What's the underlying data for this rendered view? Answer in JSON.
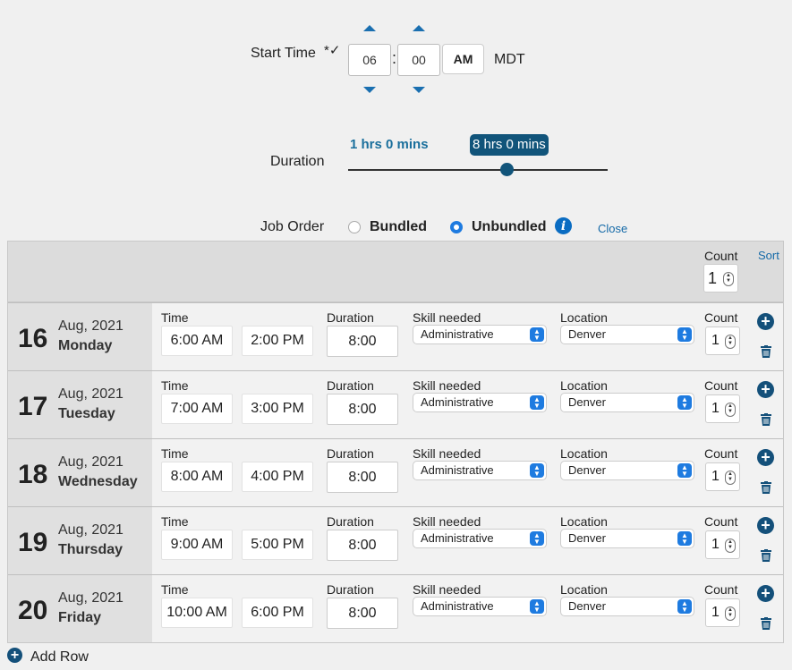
{
  "start_time": {
    "label": "Start Time",
    "required_mark": "*✓",
    "hour": "06",
    "minute": "00",
    "separator": ":",
    "ampm": "AM",
    "timezone": "MDT"
  },
  "duration": {
    "label": "Duration",
    "min_value": "1 hrs 0 mins",
    "current_value": "8 hrs 0 mins",
    "slider_fraction": 0.61
  },
  "job_order": {
    "label": "Job Order",
    "options": [
      "Bundled",
      "Unbundled"
    ],
    "selected": "Unbundled",
    "close_label": "Close"
  },
  "header": {
    "count_label": "Count",
    "count_value": "1",
    "sort_label": "Sort"
  },
  "labels": {
    "time": "Time",
    "duration": "Duration",
    "skill": "Skill needed",
    "location": "Location",
    "count": "Count"
  },
  "rows": [
    {
      "day": "16",
      "month_year": "Aug, 2021",
      "weekday": "Monday",
      "start": "6:00 AM",
      "end": "2:00 PM",
      "duration": "8:00",
      "skill": "Administrative",
      "location": "Denver",
      "count": "1"
    },
    {
      "day": "17",
      "month_year": "Aug, 2021",
      "weekday": "Tuesday",
      "start": "7:00 AM",
      "end": "3:00 PM",
      "duration": "8:00",
      "skill": "Administrative",
      "location": "Denver",
      "count": "1"
    },
    {
      "day": "18",
      "month_year": "Aug, 2021",
      "weekday": "Wednesday",
      "start": "8:00 AM",
      "end": "4:00 PM",
      "duration": "8:00",
      "skill": "Administrative",
      "location": "Denver",
      "count": "1"
    },
    {
      "day": "19",
      "month_year": "Aug, 2021",
      "weekday": "Thursday",
      "start": "9:00 AM",
      "end": "5:00 PM",
      "duration": "8:00",
      "skill": "Administrative",
      "location": "Denver",
      "count": "1"
    },
    {
      "day": "20",
      "month_year": "Aug, 2021",
      "weekday": "Friday",
      "start": "10:00 AM",
      "end": "6:00 PM",
      "duration": "8:00",
      "skill": "Administrative",
      "location": "Denver",
      "count": "1"
    }
  ],
  "add_row_label": "Add Row",
  "colors": {
    "accent": "#1a6fb0",
    "dark_accent": "#11547a",
    "radio_selected": "#1e7be0"
  }
}
